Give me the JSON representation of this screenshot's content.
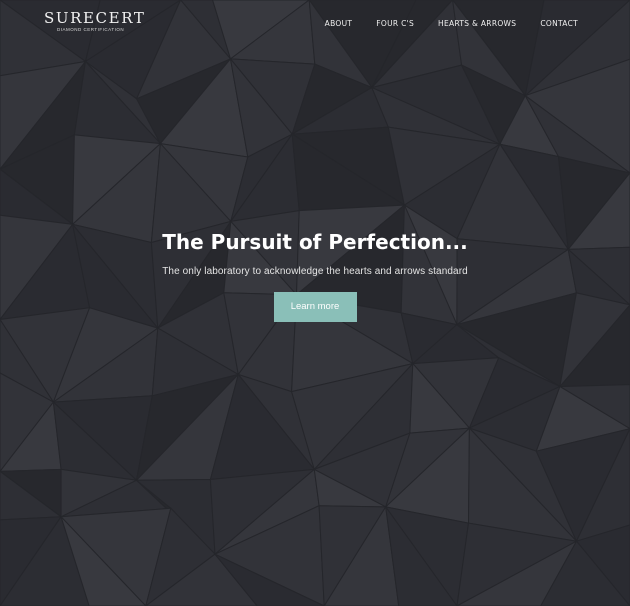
{
  "brand": {
    "name": "Surecert",
    "tagline": "Diamond Certification"
  },
  "nav": [
    {
      "label": "About"
    },
    {
      "label": "Four C's"
    },
    {
      "label": "Hearts & Arrows"
    },
    {
      "label": "Contact"
    }
  ],
  "hero": {
    "title": "The Pursuit of Perfection...",
    "subtitle": "The only laboratory to acknowledge the hearts and arrows standard",
    "cta_label": "Learn more"
  },
  "colors": {
    "background": "#2c2d33",
    "accent": "#8abfb8",
    "text": "#ffffff"
  }
}
